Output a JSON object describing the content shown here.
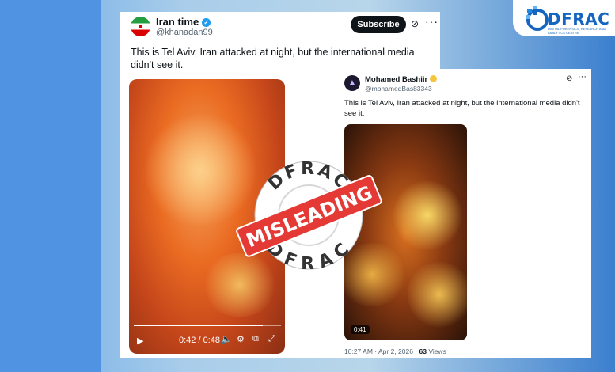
{
  "brand": {
    "logo_text": "DFRAC",
    "tagline": "DIGITAL FORENSICS, RESEARCH AND ANALYTICS CENTRE"
  },
  "post_primary": {
    "display_name": "Iran time",
    "handle": "@khanadan99",
    "subscribe_label": "Subscribe",
    "text": "This is Tel Aviv, Iran attacked at night, but the international media didn't see it.",
    "video": {
      "current_time": "0:42",
      "duration": "0:48",
      "time_display": "0:42 / 0:48",
      "progress": 0.875
    }
  },
  "post_secondary": {
    "display_name": "Mohamed Bashiir",
    "handle": "@mohamedBas83343",
    "text": "This is Tel Aviv, Iran attacked at night, but the international media didn't see it.",
    "video": {
      "duration": "0:41"
    },
    "timestamp": "10:27 AM · Apr 2, 2026 · ",
    "views_count": "63",
    "views_label": " Views"
  },
  "stamp": {
    "top_text": "DFRAC",
    "bottom_text": "DFRAC",
    "verdict": "MISLEADING",
    "color": "#e53935"
  },
  "colors": {
    "accent": "#1565c0",
    "verified": "#1d9bf0",
    "stamp": "#e53935"
  },
  "icons": [
    "verified-badge-icon",
    "grok-icon",
    "more-options-icon",
    "play-icon",
    "volume-icon",
    "settings-icon",
    "pip-icon",
    "fullscreen-icon"
  ]
}
